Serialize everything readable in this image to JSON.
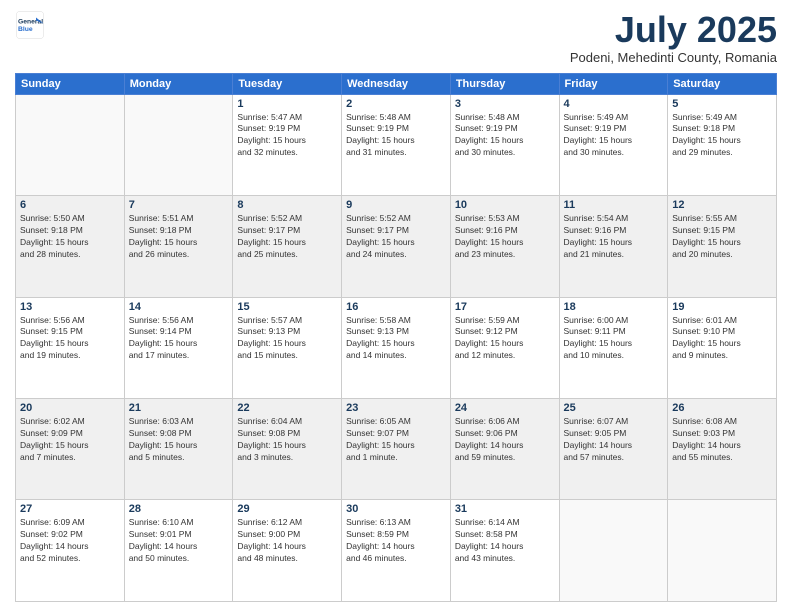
{
  "header": {
    "logo_line1": "General",
    "logo_line2": "Blue",
    "month_title": "July 2025",
    "location": "Podeni, Mehedinti County, Romania"
  },
  "days_of_week": [
    "Sunday",
    "Monday",
    "Tuesday",
    "Wednesday",
    "Thursday",
    "Friday",
    "Saturday"
  ],
  "weeks": [
    {
      "shaded": false,
      "days": [
        {
          "number": "",
          "content": ""
        },
        {
          "number": "",
          "content": ""
        },
        {
          "number": "1",
          "content": "Sunrise: 5:47 AM\nSunset: 9:19 PM\nDaylight: 15 hours\nand 32 minutes."
        },
        {
          "number": "2",
          "content": "Sunrise: 5:48 AM\nSunset: 9:19 PM\nDaylight: 15 hours\nand 31 minutes."
        },
        {
          "number": "3",
          "content": "Sunrise: 5:48 AM\nSunset: 9:19 PM\nDaylight: 15 hours\nand 30 minutes."
        },
        {
          "number": "4",
          "content": "Sunrise: 5:49 AM\nSunset: 9:19 PM\nDaylight: 15 hours\nand 30 minutes."
        },
        {
          "number": "5",
          "content": "Sunrise: 5:49 AM\nSunset: 9:18 PM\nDaylight: 15 hours\nand 29 minutes."
        }
      ]
    },
    {
      "shaded": true,
      "days": [
        {
          "number": "6",
          "content": "Sunrise: 5:50 AM\nSunset: 9:18 PM\nDaylight: 15 hours\nand 28 minutes."
        },
        {
          "number": "7",
          "content": "Sunrise: 5:51 AM\nSunset: 9:18 PM\nDaylight: 15 hours\nand 26 minutes."
        },
        {
          "number": "8",
          "content": "Sunrise: 5:52 AM\nSunset: 9:17 PM\nDaylight: 15 hours\nand 25 minutes."
        },
        {
          "number": "9",
          "content": "Sunrise: 5:52 AM\nSunset: 9:17 PM\nDaylight: 15 hours\nand 24 minutes."
        },
        {
          "number": "10",
          "content": "Sunrise: 5:53 AM\nSunset: 9:16 PM\nDaylight: 15 hours\nand 23 minutes."
        },
        {
          "number": "11",
          "content": "Sunrise: 5:54 AM\nSunset: 9:16 PM\nDaylight: 15 hours\nand 21 minutes."
        },
        {
          "number": "12",
          "content": "Sunrise: 5:55 AM\nSunset: 9:15 PM\nDaylight: 15 hours\nand 20 minutes."
        }
      ]
    },
    {
      "shaded": false,
      "days": [
        {
          "number": "13",
          "content": "Sunrise: 5:56 AM\nSunset: 9:15 PM\nDaylight: 15 hours\nand 19 minutes."
        },
        {
          "number": "14",
          "content": "Sunrise: 5:56 AM\nSunset: 9:14 PM\nDaylight: 15 hours\nand 17 minutes."
        },
        {
          "number": "15",
          "content": "Sunrise: 5:57 AM\nSunset: 9:13 PM\nDaylight: 15 hours\nand 15 minutes."
        },
        {
          "number": "16",
          "content": "Sunrise: 5:58 AM\nSunset: 9:13 PM\nDaylight: 15 hours\nand 14 minutes."
        },
        {
          "number": "17",
          "content": "Sunrise: 5:59 AM\nSunset: 9:12 PM\nDaylight: 15 hours\nand 12 minutes."
        },
        {
          "number": "18",
          "content": "Sunrise: 6:00 AM\nSunset: 9:11 PM\nDaylight: 15 hours\nand 10 minutes."
        },
        {
          "number": "19",
          "content": "Sunrise: 6:01 AM\nSunset: 9:10 PM\nDaylight: 15 hours\nand 9 minutes."
        }
      ]
    },
    {
      "shaded": true,
      "days": [
        {
          "number": "20",
          "content": "Sunrise: 6:02 AM\nSunset: 9:09 PM\nDaylight: 15 hours\nand 7 minutes."
        },
        {
          "number": "21",
          "content": "Sunrise: 6:03 AM\nSunset: 9:08 PM\nDaylight: 15 hours\nand 5 minutes."
        },
        {
          "number": "22",
          "content": "Sunrise: 6:04 AM\nSunset: 9:08 PM\nDaylight: 15 hours\nand 3 minutes."
        },
        {
          "number": "23",
          "content": "Sunrise: 6:05 AM\nSunset: 9:07 PM\nDaylight: 15 hours\nand 1 minute."
        },
        {
          "number": "24",
          "content": "Sunrise: 6:06 AM\nSunset: 9:06 PM\nDaylight: 14 hours\nand 59 minutes."
        },
        {
          "number": "25",
          "content": "Sunrise: 6:07 AM\nSunset: 9:05 PM\nDaylight: 14 hours\nand 57 minutes."
        },
        {
          "number": "26",
          "content": "Sunrise: 6:08 AM\nSunset: 9:03 PM\nDaylight: 14 hours\nand 55 minutes."
        }
      ]
    },
    {
      "shaded": false,
      "days": [
        {
          "number": "27",
          "content": "Sunrise: 6:09 AM\nSunset: 9:02 PM\nDaylight: 14 hours\nand 52 minutes."
        },
        {
          "number": "28",
          "content": "Sunrise: 6:10 AM\nSunset: 9:01 PM\nDaylight: 14 hours\nand 50 minutes."
        },
        {
          "number": "29",
          "content": "Sunrise: 6:12 AM\nSunset: 9:00 PM\nDaylight: 14 hours\nand 48 minutes."
        },
        {
          "number": "30",
          "content": "Sunrise: 6:13 AM\nSunset: 8:59 PM\nDaylight: 14 hours\nand 46 minutes."
        },
        {
          "number": "31",
          "content": "Sunrise: 6:14 AM\nSunset: 8:58 PM\nDaylight: 14 hours\nand 43 minutes."
        },
        {
          "number": "",
          "content": ""
        },
        {
          "number": "",
          "content": ""
        }
      ]
    }
  ]
}
